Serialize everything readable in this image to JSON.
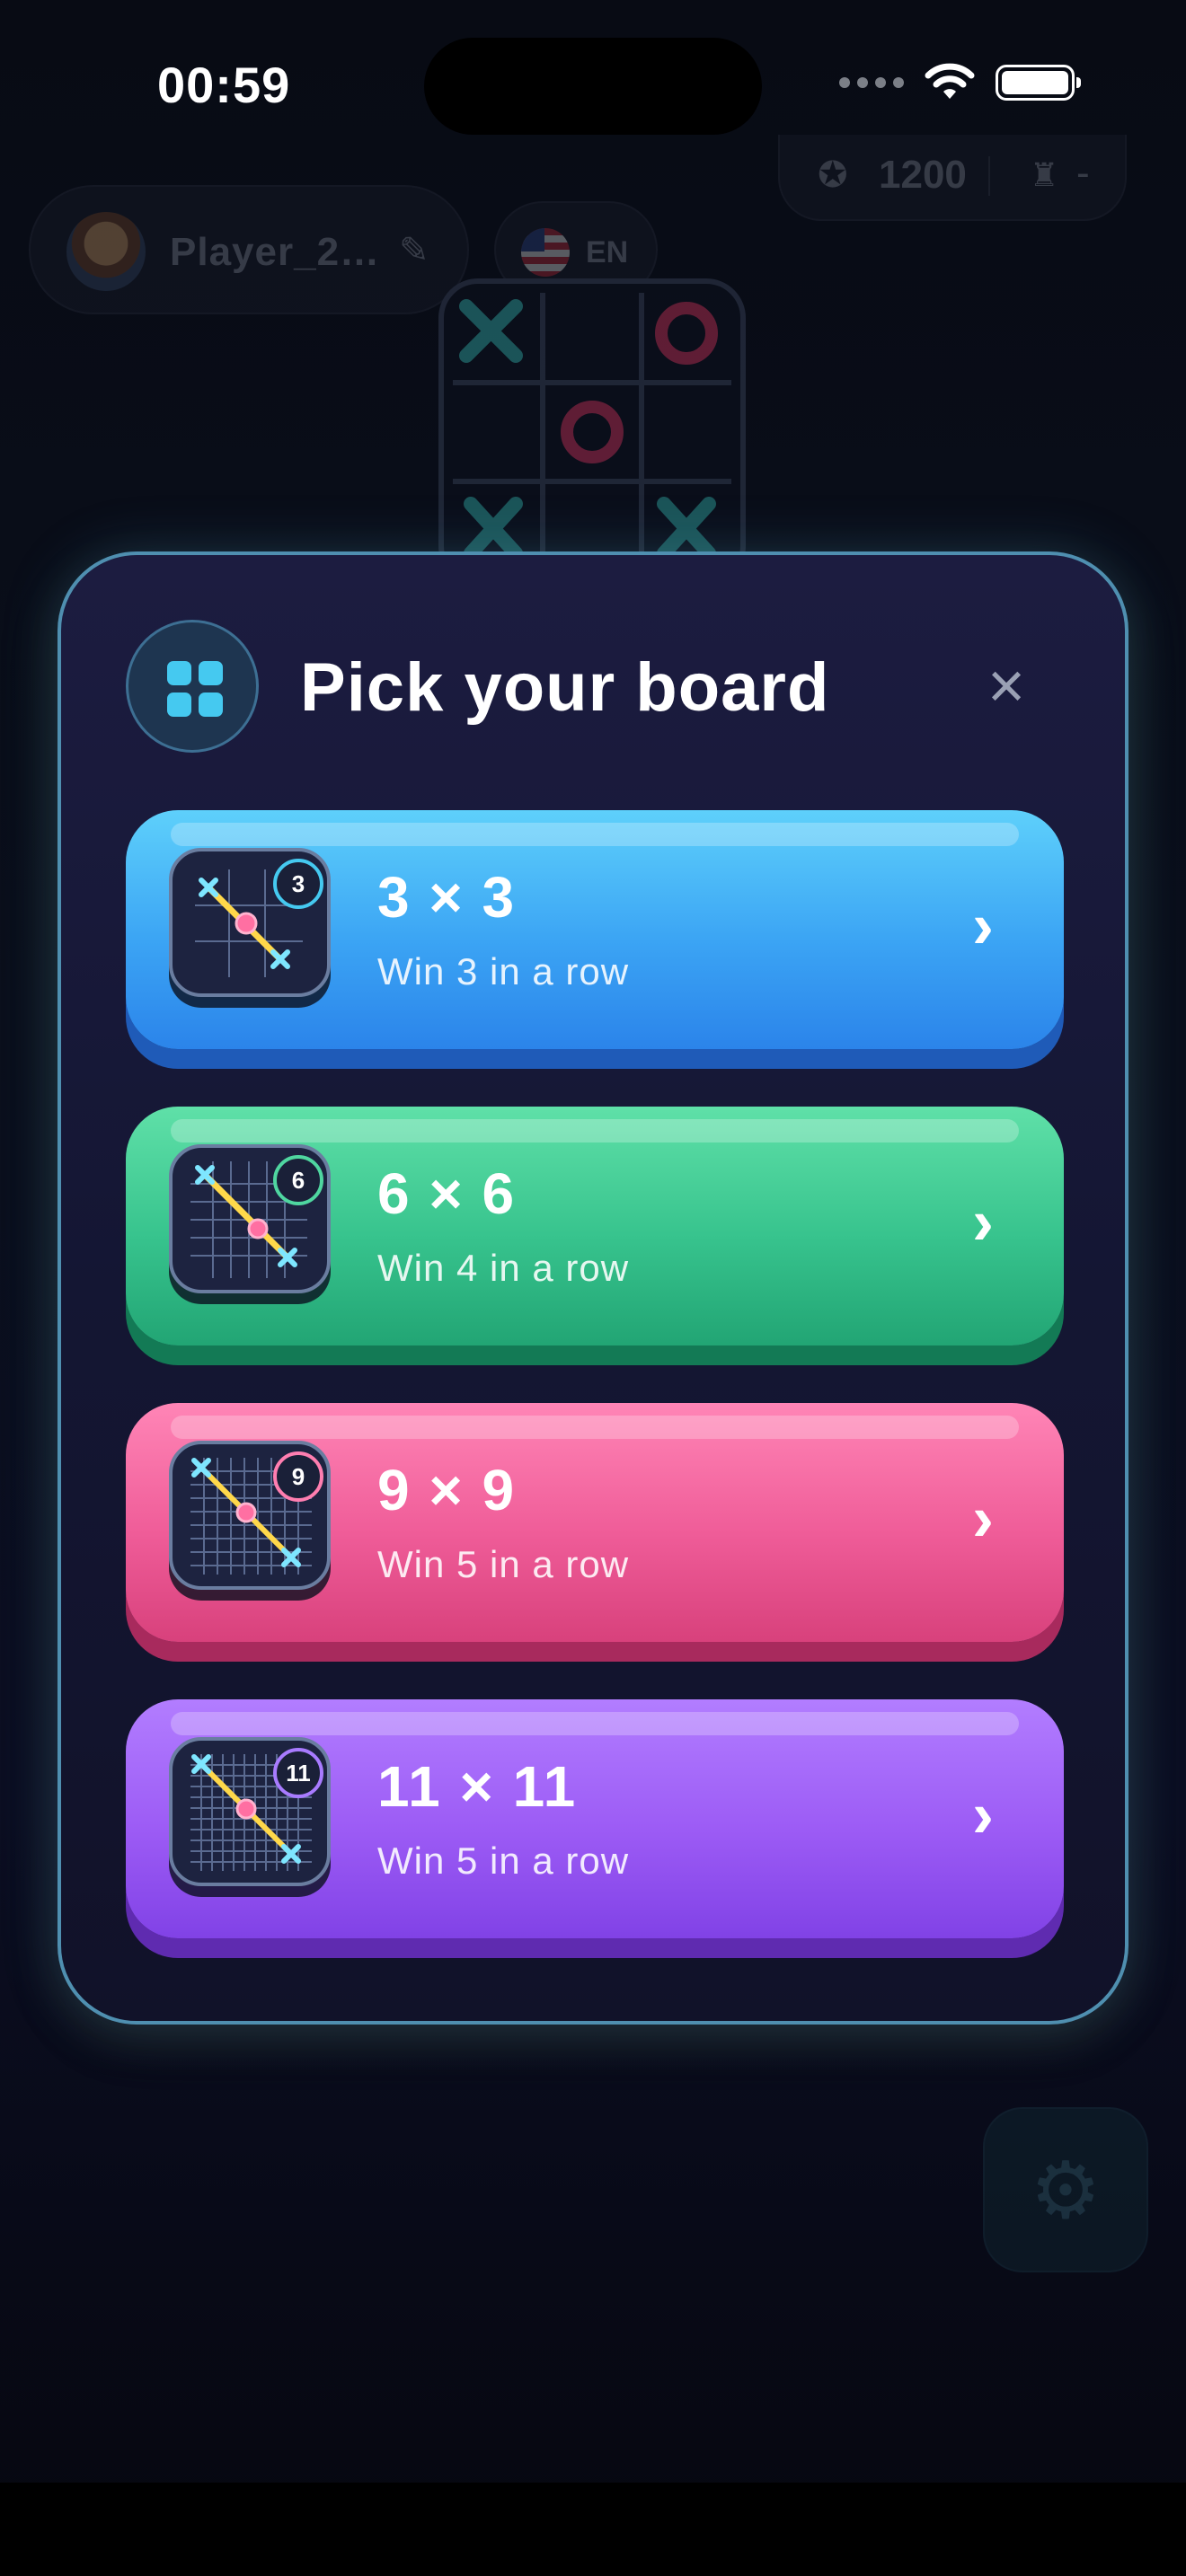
{
  "status_bar": {
    "time": "00:59"
  },
  "background": {
    "player_name": "Player_2…",
    "language_code": "EN",
    "score": "1200",
    "rank": "-"
  },
  "modal": {
    "title": "Pick your board",
    "options": [
      {
        "size": "3",
        "title": "3 × 3",
        "subtitle": "Win 3 in a row",
        "color": "#3ba4f4",
        "badge_color": "#45c9f0"
      },
      {
        "size": "6",
        "title": "6 × 6",
        "subtitle": "Win 4 in a row",
        "color": "#37c38d",
        "badge_color": "#4fd6a0"
      },
      {
        "size": "9",
        "title": "9 × 9",
        "subtitle": "Win 5 in a row",
        "color": "#ef5c98",
        "badge_color": "#ff7eb0"
      },
      {
        "size": "11",
        "title": "11 × 11",
        "subtitle": "Win 5 in a row",
        "color": "#9c5bf5",
        "badge_color": "#a87bff"
      }
    ]
  }
}
